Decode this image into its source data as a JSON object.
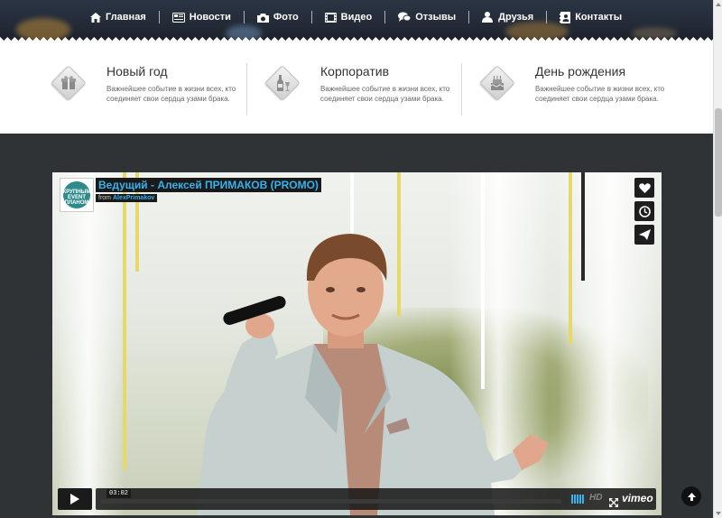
{
  "nav": {
    "items": [
      {
        "label": "Главная",
        "icon": "home-icon"
      },
      {
        "label": "Новости",
        "icon": "news-icon"
      },
      {
        "label": "Фото",
        "icon": "camera-icon"
      },
      {
        "label": "Видео",
        "icon": "film-icon"
      },
      {
        "label": "Отзывы",
        "icon": "comments-icon"
      },
      {
        "label": "Друзья",
        "icon": "users-icon"
      },
      {
        "label": "Контакты",
        "icon": "contact-book-icon"
      }
    ]
  },
  "features": [
    {
      "title": "Новый год",
      "desc": "Важнейшее событие в жизни всех, кто соединяет свои сердца узами брака.",
      "icon": "gift-icon"
    },
    {
      "title": "Корпоратив",
      "desc": "Важнейшее событие в жизни всех, кто соединяет свои сердца узами брака.",
      "icon": "bottle-glass-icon"
    },
    {
      "title": "День рождения",
      "desc": "Важнейшее событие в жизни всех, кто соединяет свои сердца узами брака.",
      "icon": "cake-icon"
    }
  ],
  "video": {
    "title": "Ведущий - Алексей ПРИМАКОВ (PROMO)",
    "from_label": "from",
    "author": "AlexPrimakov",
    "logo_text": "КРУПНЫМ EVENT ПЛАНОМ",
    "duration": "03:02",
    "progress": 0.0,
    "hd_label": "HD",
    "brand": "vimeo"
  },
  "colors": {
    "accent": "#36b3ee",
    "dark_bg": "#303335",
    "nav_text": "#ffffff"
  }
}
